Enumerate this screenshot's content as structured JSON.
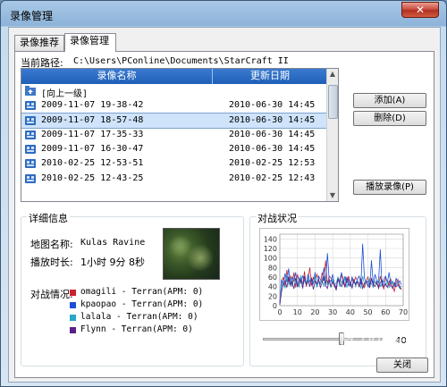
{
  "window": {
    "title": "录像管理",
    "close_symbol": "✕"
  },
  "tabs": [
    {
      "label": "录像推荐",
      "active": false
    },
    {
      "label": "录像管理",
      "active": true
    }
  ],
  "path": {
    "label": "当前路径:",
    "value": "C:\\Users\\PConline\\Documents\\StarCraft II"
  },
  "list": {
    "col_name": "录像名称",
    "col_date": "更新日期",
    "rows": [
      {
        "name": "[向上一级]",
        "date": "",
        "icon": "folder-up-icon"
      },
      {
        "name": "2009-11-07 19-38-42",
        "date": "2010-06-30 14:45",
        "icon": "replay-icon"
      },
      {
        "name": "2009-11-07 18-57-48",
        "date": "2010-06-30 14:45",
        "icon": "replay-icon",
        "selected": true
      },
      {
        "name": "2009-11-07 17-35-33",
        "date": "2010-06-30 14:45",
        "icon": "replay-icon"
      },
      {
        "name": "2009-11-07 16-30-47",
        "date": "2010-06-30 14:45",
        "icon": "replay-icon"
      },
      {
        "name": "2010-02-25 12-53-51",
        "date": "2010-02-25 12:53",
        "icon": "replay-icon"
      },
      {
        "name": "2010-02-25 12-43-25",
        "date": "2010-02-25 12:43",
        "icon": "replay-icon"
      }
    ]
  },
  "buttons": {
    "add": "添加(A)",
    "delete": "删除(D)",
    "play": "播放录像(P)",
    "close": "关闭"
  },
  "details": {
    "title": "详细信息",
    "map_label": "地图名称:",
    "map_value": "Kulas Ravine",
    "duration_label": "播放时长:",
    "duration_value": "1小时 9分 8秒",
    "matchup_label": "对战情况:",
    "players": [
      {
        "text": "omagili - Terran(APM: 0)",
        "color": "#c8232c"
      },
      {
        "text": "kpaopao - Terran(APM: 0)",
        "color": "#1b4fd8"
      },
      {
        "text": "lalala - Terran(APM: 0)",
        "color": "#2aa7c9"
      },
      {
        "text": "Flynn - Terran(APM: 0)",
        "color": "#5b1f8a"
      }
    ]
  },
  "battle": {
    "title": "对战状况",
    "slider_value": "40",
    "slider_fraction": 0.66
  },
  "watermark": {
    "brand": "PConline",
    "sub": "太平洋电脑网"
  },
  "chart_data": {
    "type": "line",
    "x_ticks": [
      "0",
      "10",
      "20",
      "30",
      "40",
      "50",
      "60",
      "70"
    ],
    "y_ticks": [
      "0",
      "20",
      "40",
      "60",
      "80",
      "100",
      "120",
      "140"
    ],
    "xlim": [
      0,
      70
    ],
    "ylim": [
      0,
      150
    ],
    "grid": true,
    "series": [
      {
        "color": "#c8232c",
        "values": [
          5,
          48,
          60,
          40,
          75,
          50,
          62,
          45,
          70,
          38,
          66,
          52,
          58,
          44,
          72,
          40,
          55,
          80,
          42,
          60,
          48,
          66,
          55,
          44,
          70,
          52,
          95,
          45,
          62,
          58,
          50,
          40,
          35,
          60,
          48,
          66,
          58,
          40,
          50,
          62,
          44,
          55,
          48,
          60,
          52,
          40,
          55,
          46,
          38,
          52,
          60,
          44,
          58,
          42,
          50,
          48,
          40,
          62,
          44,
          35,
          58,
          50,
          42,
          55,
          40,
          30,
          48,
          55,
          40,
          35
        ]
      },
      {
        "color": "#1b4fd8",
        "values": [
          3,
          55,
          42,
          68,
          50,
          78,
          45,
          60,
          52,
          70,
          40,
          58,
          48,
          62,
          54,
          44,
          66,
          50,
          58,
          46,
          70,
          40,
          62,
          55,
          48,
          80,
          42,
          110,
          55,
          50,
          66,
          45,
          38,
          58,
          52,
          70,
          44,
          62,
          48,
          56,
          40,
          60,
          50,
          46,
          55,
          62,
          44,
          130,
          58,
          48,
          52,
          40,
          95,
          44,
          66,
          52,
          48,
          118,
          40,
          55,
          62,
          48,
          70,
          45,
          50,
          40,
          58,
          46,
          52,
          44
        ]
      },
      {
        "color": "#2aa7c9",
        "values": [
          4,
          40,
          50,
          36,
          62,
          44,
          55,
          40,
          58,
          46,
          50,
          38,
          64,
          42,
          52,
          48,
          58,
          40,
          56,
          44,
          62,
          38,
          50,
          46,
          54,
          40,
          60,
          44,
          50,
          38,
          56,
          42,
          48,
          60,
          40,
          52,
          44,
          58,
          38,
          50,
          46,
          42,
          56,
          40,
          52,
          48,
          36,
          62,
          44,
          50,
          40,
          58,
          46,
          38,
          52,
          44,
          56,
          40,
          48,
          54,
          42,
          50,
          38,
          46,
          52,
          40,
          44,
          48,
          36,
          42
        ]
      },
      {
        "color": "#5b1f8a",
        "values": [
          2,
          30,
          45,
          52,
          38,
          60,
          42,
          50,
          35,
          58,
          40,
          48,
          55,
          36,
          62,
          44,
          52,
          40,
          58,
          34,
          50,
          46,
          56,
          38,
          48,
          60,
          42,
          36,
          54,
          40,
          50,
          44,
          32,
          56,
          46,
          40,
          52,
          38,
          60,
          42,
          48,
          36,
          54,
          44,
          50,
          40,
          58,
          36,
          46,
          52,
          42,
          38,
          56,
          44,
          40,
          50,
          36,
          48,
          54,
          40,
          46,
          38,
          52,
          42,
          36,
          48,
          40,
          44,
          38,
          34
        ]
      }
    ]
  }
}
